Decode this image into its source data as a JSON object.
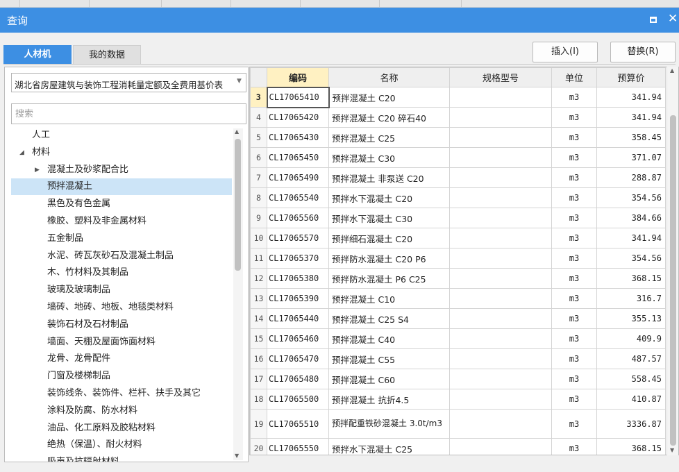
{
  "dialog": {
    "title": "查询"
  },
  "tabs": [
    {
      "label": "人材机"
    },
    {
      "label": "我的数据"
    }
  ],
  "actions": {
    "insert_label": "插入(I)",
    "replace_label": "替换(R)"
  },
  "quota_library": {
    "selected": "湖北省房屋建筑与装饰工程消耗量定额及全费用基价表"
  },
  "search": {
    "placeholder": "搜索",
    "value": ""
  },
  "tree": {
    "selected_index": 3,
    "items": [
      {
        "label": "人工",
        "level": 1,
        "expander": ""
      },
      {
        "label": "材料",
        "level": 1,
        "expander": "◢"
      },
      {
        "label": "混凝土及砂浆配合比",
        "level": 2,
        "expander": "▶"
      },
      {
        "label": "预拌混凝土",
        "level": 2,
        "expander": ""
      },
      {
        "label": "黑色及有色金属",
        "level": 2,
        "expander": ""
      },
      {
        "label": "橡胶、塑料及非金属材料",
        "level": 2,
        "expander": ""
      },
      {
        "label": "五金制品",
        "level": 2,
        "expander": ""
      },
      {
        "label": "水泥、砖瓦灰砂石及混凝土制品",
        "level": 2,
        "expander": ""
      },
      {
        "label": "木、竹材料及其制品",
        "level": 2,
        "expander": ""
      },
      {
        "label": "玻璃及玻璃制品",
        "level": 2,
        "expander": ""
      },
      {
        "label": "墙砖、地砖、地板、地毯类材料",
        "level": 2,
        "expander": ""
      },
      {
        "label": "装饰石材及石材制品",
        "level": 2,
        "expander": ""
      },
      {
        "label": "墙面、天棚及屋面饰面材料",
        "level": 2,
        "expander": ""
      },
      {
        "label": "龙骨、龙骨配件",
        "level": 2,
        "expander": ""
      },
      {
        "label": "门窗及楼梯制品",
        "level": 2,
        "expander": ""
      },
      {
        "label": "装饰线条、装饰件、栏杆、扶手及其它",
        "level": 2,
        "expander": ""
      },
      {
        "label": "涂料及防腐、防水材料",
        "level": 2,
        "expander": ""
      },
      {
        "label": "油品、化工原料及胶粘材料",
        "level": 2,
        "expander": ""
      },
      {
        "label": "绝热（保温）、耐火材料",
        "level": 2,
        "expander": ""
      },
      {
        "label": "吸声及抗辐射材料",
        "level": 2,
        "expander": ""
      }
    ]
  },
  "grid": {
    "columns": [
      "编码",
      "名称",
      "规格型号",
      "单位",
      "预算价"
    ],
    "current_row_index": 0,
    "rows": [
      {
        "no": "3",
        "code": "CL17065410",
        "name": "预拌混凝土 C20",
        "spec": "",
        "unit": "m3",
        "price": "341.94"
      },
      {
        "no": "4",
        "code": "CL17065420",
        "name": "预拌混凝土 C20 碎石40",
        "spec": "",
        "unit": "m3",
        "price": "341.94"
      },
      {
        "no": "5",
        "code": "CL17065430",
        "name": "预拌混凝土 C25",
        "spec": "",
        "unit": "m3",
        "price": "358.45"
      },
      {
        "no": "6",
        "code": "CL17065450",
        "name": "预拌混凝土 C30",
        "spec": "",
        "unit": "m3",
        "price": "371.07"
      },
      {
        "no": "7",
        "code": "CL17065490",
        "name": "预拌混凝土 非泵送 C20",
        "spec": "",
        "unit": "m3",
        "price": "288.87"
      },
      {
        "no": "8",
        "code": "CL17065540",
        "name": "预拌水下混凝土 C20",
        "spec": "",
        "unit": "m3",
        "price": "354.56"
      },
      {
        "no": "9",
        "code": "CL17065560",
        "name": "预拌水下混凝土 C30",
        "spec": "",
        "unit": "m3",
        "price": "384.66"
      },
      {
        "no": "10",
        "code": "CL17065570",
        "name": "预拌细石混凝土 C20",
        "spec": "",
        "unit": "m3",
        "price": "341.94"
      },
      {
        "no": "11",
        "code": "CL17065370",
        "name": "预拌防水混凝土 C20 P6",
        "spec": "",
        "unit": "m3",
        "price": "354.56"
      },
      {
        "no": "12",
        "code": "CL17065380",
        "name": "预拌防水混凝土 P6 C25",
        "spec": "",
        "unit": "m3",
        "price": "368.15"
      },
      {
        "no": "13",
        "code": "CL17065390",
        "name": "预拌混凝土 C10",
        "spec": "",
        "unit": "m3",
        "price": "316.7"
      },
      {
        "no": "14",
        "code": "CL17065440",
        "name": "预拌混凝土 C25 S4",
        "spec": "",
        "unit": "m3",
        "price": "355.13"
      },
      {
        "no": "15",
        "code": "CL17065460",
        "name": "预拌混凝土 C40",
        "spec": "",
        "unit": "m3",
        "price": "409.9"
      },
      {
        "no": "16",
        "code": "CL17065470",
        "name": "预拌混凝土 C55",
        "spec": "",
        "unit": "m3",
        "price": "487.57"
      },
      {
        "no": "17",
        "code": "CL17065480",
        "name": "预拌混凝土 C60",
        "spec": "",
        "unit": "m3",
        "price": "558.45"
      },
      {
        "no": "18",
        "code": "CL17065500",
        "name": "预拌混凝土 抗折4.5",
        "spec": "",
        "unit": "m3",
        "price": "410.87"
      },
      {
        "no": "19",
        "code": "CL17065510",
        "name": "预拌配重铁砂混凝土 3.0t/m3",
        "spec": "",
        "unit": "m3",
        "price": "3336.87"
      },
      {
        "no": "20",
        "code": "CL17065550",
        "name": "预拌水下混凝土 C25",
        "spec": "",
        "unit": "m3",
        "price": "368.15"
      }
    ]
  }
}
